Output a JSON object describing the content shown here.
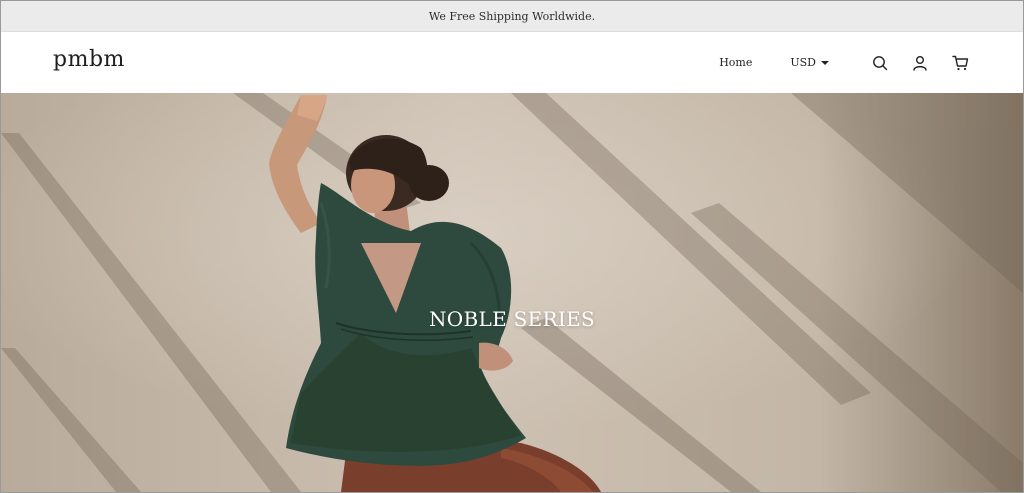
{
  "announcement": "We Free Shipping Worldwide.",
  "header": {
    "logo": "pmbm",
    "nav": {
      "home_label": "Home",
      "currency_label": "USD"
    },
    "icons": [
      "search-icon",
      "account-icon",
      "cart-icon"
    ]
  },
  "hero": {
    "title": "NOBLE SERIES",
    "image": "woman-in-green-blouse-photo"
  },
  "colors": {
    "announcement_bg": "#ebebeb",
    "header_bg": "#ffffff",
    "hero_wall": "#c8bcae",
    "blouse": "#2e4a3e",
    "title_text": "#ffffff"
  }
}
